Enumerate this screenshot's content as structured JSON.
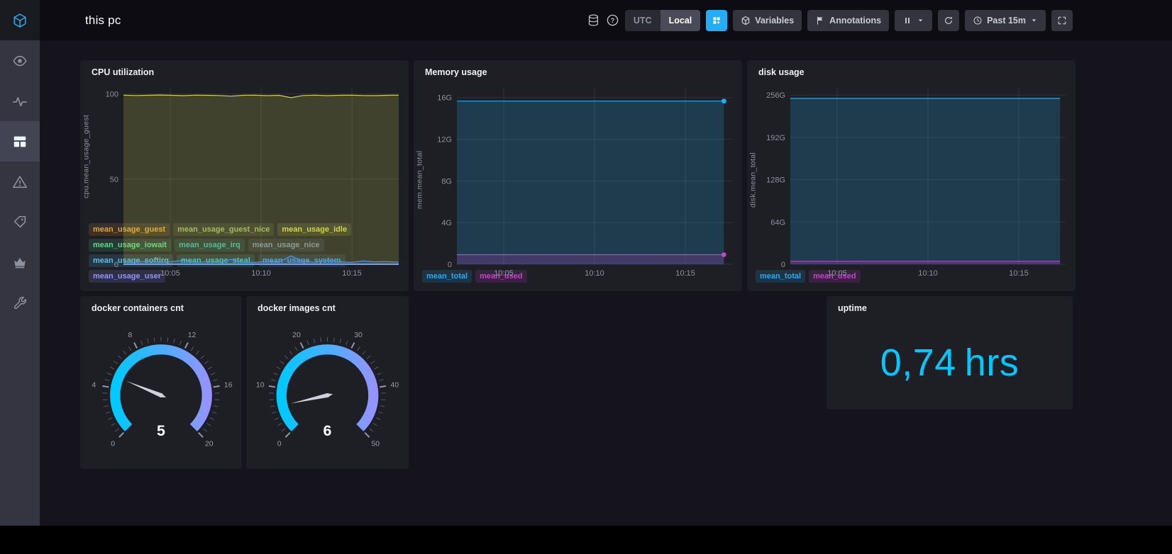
{
  "header": {
    "title": "this pc",
    "timezone": {
      "options": [
        "UTC",
        "Local"
      ],
      "selected": "Local"
    },
    "variables_label": "Variables",
    "annotations_label": "Annotations",
    "time_range_label": "Past 15m",
    "icons": [
      "database-icon",
      "help-icon",
      "add-cell-icon",
      "cube-icon",
      "flag-icon",
      "pause-icon",
      "caret-down-icon",
      "refresh-icon",
      "clock-icon",
      "expand-icon"
    ]
  },
  "sidebar": {
    "items": [
      {
        "id": "home",
        "icon": "chronograf-logo-icon",
        "active": false
      },
      {
        "id": "status",
        "icon": "eye-icon",
        "active": false
      },
      {
        "id": "data-explorer",
        "icon": "pulse-icon",
        "active": false
      },
      {
        "id": "dashboards",
        "icon": "dashboards-icon",
        "active": true
      },
      {
        "id": "alerting",
        "icon": "alert-triangle-icon",
        "active": false
      },
      {
        "id": "integrations",
        "icon": "tags-icon",
        "active": false
      },
      {
        "id": "admin",
        "icon": "crown-icon",
        "active": false
      },
      {
        "id": "configuration",
        "icon": "wrench-icon",
        "active": false
      }
    ]
  },
  "panels": {
    "cpu": {
      "title": "CPU utilization",
      "chart_data": {
        "type": "line",
        "ylabel": "cpu.mean_usage_guest",
        "ylim": [
          0,
          104
        ],
        "y_ticks": [
          0,
          50,
          100
        ],
        "y_tick_labels": [
          "0",
          "50",
          "100"
        ],
        "x_ticks": [
          "10:05",
          "10:10",
          "10:15"
        ],
        "x_tick_pos": [
          0.17,
          0.5,
          0.83
        ],
        "series": [
          {
            "name": "mean_usage_guest",
            "color": "#E1A13C",
            "const": 0
          },
          {
            "name": "mean_usage_guest_nice",
            "color": "#9BB365",
            "const": 0
          },
          {
            "name": "mean_usage_idle",
            "color": "#CFD34F",
            "values": [
              99.3,
              99.1,
              99.2,
              99.4,
              99.2,
              99.0,
              99.3,
              99.2,
              99.1,
              98.7,
              99.2,
              99.3,
              99.0,
              99.2,
              97.8,
              99.1,
              99.3,
              99.0,
              99.2,
              99.3,
              99.1,
              99.0,
              99.2,
              99.3
            ]
          },
          {
            "name": "mean_usage_iowait",
            "color": "#5ED88A",
            "const": 0
          },
          {
            "name": "mean_usage_irq",
            "color": "#3BB5A8",
            "const": 0
          },
          {
            "name": "mean_usage_nice",
            "color": "#7D8DA3",
            "const": 0
          },
          {
            "name": "mean_usage_softirq",
            "color": "#59C0E8",
            "const": 0
          },
          {
            "name": "mean_usage_steal",
            "color": "#2FC9CF",
            "const": 0
          },
          {
            "name": "mean_usage_system",
            "color": "#4198EC",
            "values": [
              1.4,
              1.1,
              1.8,
              1.2,
              1.5,
              2.3,
              1.0,
              1.6,
              1.3,
              2.9,
              1.2,
              1.1,
              1.7,
              1.4,
              4.9,
              1.8,
              1.2,
              2.2,
              1.5,
              1.1,
              1.9,
              1.4,
              1.6,
              1.2
            ]
          },
          {
            "name": "mean_usage_user",
            "color": "#9394FF",
            "const": 0
          }
        ]
      }
    },
    "memory": {
      "title": "Memory usage",
      "chart_data": {
        "type": "line",
        "ylabel": "mem.mean_total",
        "ylim": [
          0,
          17
        ],
        "y_ticks": [
          0,
          4,
          8,
          12,
          16
        ],
        "y_tick_labels": [
          "0",
          "4G",
          "8G",
          "12G",
          "16G"
        ],
        "x_ticks": [
          "10:05",
          "10:10",
          "10:15"
        ],
        "x_tick_pos": [
          0.17,
          0.5,
          0.83
        ],
        "x_end": 0.97,
        "series": [
          {
            "name": "mean_total",
            "color": "#22ADF6",
            "const": 15.66,
            "end_dot": true
          },
          {
            "name": "mean_used",
            "color": "#C941CE",
            "const": 0.92,
            "end_dot": true
          }
        ]
      }
    },
    "disk": {
      "title": "disk usage",
      "chart_data": {
        "type": "line",
        "ylabel": "disk.mean_total",
        "ylim": [
          0,
          268
        ],
        "y_ticks": [
          0,
          64,
          128,
          192,
          256
        ],
        "y_tick_labels": [
          "0",
          "64G",
          "128G",
          "192G",
          "256G"
        ],
        "x_ticks": [
          "10:05",
          "10:10",
          "10:15"
        ],
        "x_tick_pos": [
          0.17,
          0.5,
          0.83
        ],
        "x_end": 0.98,
        "series": [
          {
            "name": "mean_total",
            "color": "#22ADF6",
            "const": 251
          },
          {
            "name": "mean_used",
            "color": "#C941CE",
            "const": 4.5
          }
        ]
      }
    },
    "docker_containers": {
      "title": "docker containers cnt",
      "chart_data": {
        "type": "gauge",
        "min": 0,
        "max": 20,
        "value": 5,
        "major_ticks": [
          0,
          4,
          8,
          12,
          16,
          20
        ],
        "minor_step": 0.5,
        "gradient": [
          "#00C9FF",
          "#9394FF"
        ],
        "value_color": "#ffffff"
      }
    },
    "docker_images": {
      "title": "docker images cnt",
      "chart_data": {
        "type": "gauge",
        "min": 0,
        "max": 50,
        "value": 6,
        "major_ticks": [
          0,
          10,
          20,
          30,
          40,
          50
        ],
        "minor_step": 1.25,
        "gradient": [
          "#00C9FF",
          "#9394FF"
        ],
        "value_color": "#ffffff"
      }
    },
    "uptime": {
      "title": "uptime",
      "chart_data": {
        "type": "single_stat",
        "value": "0,74",
        "suffix": "hrs",
        "color": "#00C9FF"
      }
    }
  }
}
